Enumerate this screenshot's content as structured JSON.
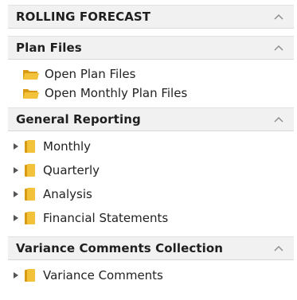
{
  "sections": {
    "top": {
      "title": "ROLLING FORECAST"
    },
    "plan_files": {
      "title": "Plan Files",
      "items": [
        {
          "label": "Open Plan Files",
          "icon": "open-folder-icon"
        },
        {
          "label": "Open Monthly Plan Files",
          "icon": "open-folder-icon"
        }
      ]
    },
    "general_reporting": {
      "title": "General Reporting",
      "items": [
        {
          "label": "Monthly",
          "icon": "folder-icon"
        },
        {
          "label": "Quarterly",
          "icon": "folder-icon"
        },
        {
          "label": "Analysis",
          "icon": "folder-icon"
        },
        {
          "label": "Financial Statements",
          "icon": "folder-icon"
        }
      ]
    },
    "variance": {
      "title": "Variance Comments Collection",
      "items": [
        {
          "label": "Variance Comments",
          "icon": "folder-icon"
        }
      ]
    }
  },
  "colors": {
    "header_bg": "#f1f1f1",
    "folder_yellow": "#f2c23a",
    "folder_shadow": "#d89a12",
    "chevron": "#8a8a8a",
    "tree_arrow": "#555555"
  }
}
